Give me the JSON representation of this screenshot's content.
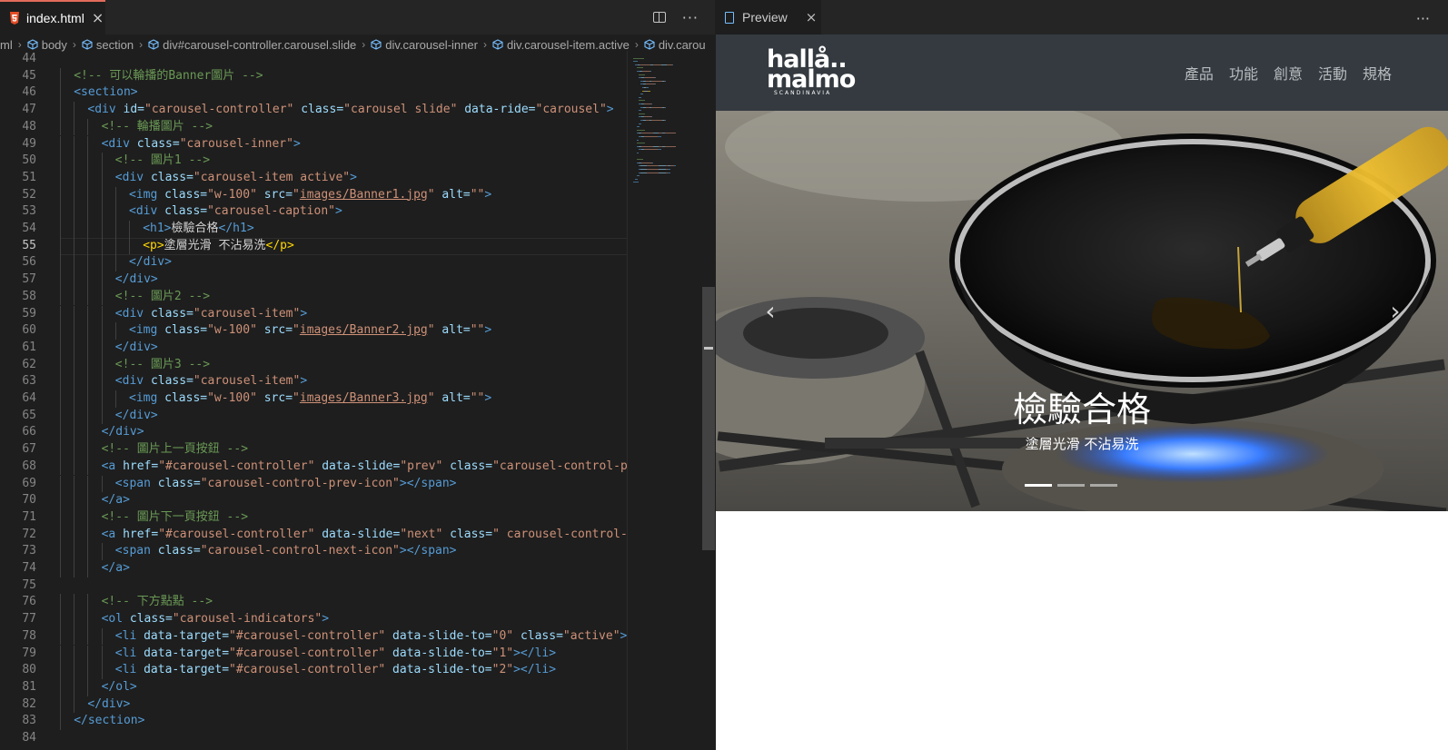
{
  "editor": {
    "tab": {
      "filename": "index.html",
      "close": "×",
      "more": "···"
    },
    "breadcrumb": [
      "ml",
      "body",
      "section",
      "div#carousel-controller.carousel.slide",
      "div.carousel-inner",
      "div.carousel-item.active",
      "div.carou"
    ],
    "lines": [
      {
        "n": "44",
        "indent": 0,
        "tokens": []
      },
      {
        "n": "45",
        "indent": 1,
        "tokens": [
          [
            "com",
            "<!-- 可以輪播的Banner圖片 -->"
          ]
        ]
      },
      {
        "n": "46",
        "indent": 1,
        "tokens": [
          [
            "tag",
            "<section>"
          ]
        ]
      },
      {
        "n": "47",
        "indent": 2,
        "tokens": [
          [
            "tag",
            "<div "
          ],
          [
            "attr",
            "id="
          ],
          [
            "str",
            "\"carousel-controller\" "
          ],
          [
            "attr",
            "class="
          ],
          [
            "str",
            "\"carousel slide\" "
          ],
          [
            "attr",
            "data-ride="
          ],
          [
            "str",
            "\"carousel\""
          ],
          [
            "tag",
            ">"
          ]
        ]
      },
      {
        "n": "48",
        "indent": 3,
        "tokens": [
          [
            "com",
            "<!-- 輪播圖片 -->"
          ]
        ]
      },
      {
        "n": "49",
        "indent": 3,
        "tokens": [
          [
            "tag",
            "<div "
          ],
          [
            "attr",
            "class="
          ],
          [
            "str",
            "\"carousel-inner\""
          ],
          [
            "tag",
            ">"
          ]
        ]
      },
      {
        "n": "50",
        "indent": 4,
        "tokens": [
          [
            "com",
            "<!-- 圖片1 -->"
          ]
        ]
      },
      {
        "n": "51",
        "indent": 4,
        "tokens": [
          [
            "tag",
            "<div "
          ],
          [
            "attr",
            "class="
          ],
          [
            "str",
            "\"carousel-item active\""
          ],
          [
            "tag",
            ">"
          ]
        ]
      },
      {
        "n": "52",
        "indent": 5,
        "tokens": [
          [
            "tag",
            "<img "
          ],
          [
            "attr",
            "class="
          ],
          [
            "str",
            "\"w-100\" "
          ],
          [
            "attr",
            "src="
          ],
          [
            "str",
            "\""
          ],
          [
            "link",
            "images/Banner1.jpg"
          ],
          [
            "str",
            "\" "
          ],
          [
            "attr",
            "alt="
          ],
          [
            "str",
            "\"\""
          ],
          [
            "tag",
            ">"
          ]
        ]
      },
      {
        "n": "53",
        "indent": 5,
        "tokens": [
          [
            "tag",
            "<div "
          ],
          [
            "attr",
            "class="
          ],
          [
            "str",
            "\"carousel-caption\""
          ],
          [
            "tag",
            ">"
          ]
        ]
      },
      {
        "n": "54",
        "indent": 6,
        "tokens": [
          [
            "tag",
            "<h1>"
          ],
          [
            "txt",
            "檢驗合格"
          ],
          [
            "tag",
            "</h1>"
          ]
        ]
      },
      {
        "n": "55",
        "indent": 6,
        "tokens": [
          [
            "brk",
            "<p>"
          ],
          [
            "txt",
            "塗層光滑 不沾易洗"
          ],
          [
            "brk",
            "</p>"
          ]
        ]
      },
      {
        "n": "56",
        "indent": 5,
        "tokens": [
          [
            "tag",
            "</div>"
          ]
        ]
      },
      {
        "n": "57",
        "indent": 4,
        "tokens": [
          [
            "tag",
            "</div>"
          ]
        ]
      },
      {
        "n": "58",
        "indent": 4,
        "tokens": [
          [
            "com",
            "<!-- 圖片2 -->"
          ]
        ]
      },
      {
        "n": "59",
        "indent": 4,
        "tokens": [
          [
            "tag",
            "<div "
          ],
          [
            "attr",
            "class="
          ],
          [
            "str",
            "\"carousel-item\""
          ],
          [
            "tag",
            ">"
          ]
        ]
      },
      {
        "n": "60",
        "indent": 5,
        "tokens": [
          [
            "tag",
            "<img "
          ],
          [
            "attr",
            "class="
          ],
          [
            "str",
            "\"w-100\" "
          ],
          [
            "attr",
            "src="
          ],
          [
            "str",
            "\""
          ],
          [
            "link",
            "images/Banner2.jpg"
          ],
          [
            "str",
            "\" "
          ],
          [
            "attr",
            "alt="
          ],
          [
            "str",
            "\"\""
          ],
          [
            "tag",
            ">"
          ]
        ]
      },
      {
        "n": "61",
        "indent": 4,
        "tokens": [
          [
            "tag",
            "</div>"
          ]
        ]
      },
      {
        "n": "62",
        "indent": 4,
        "tokens": [
          [
            "com",
            "<!-- 圖片3 -->"
          ]
        ]
      },
      {
        "n": "63",
        "indent": 4,
        "tokens": [
          [
            "tag",
            "<div "
          ],
          [
            "attr",
            "class="
          ],
          [
            "str",
            "\"carousel-item\""
          ],
          [
            "tag",
            ">"
          ]
        ]
      },
      {
        "n": "64",
        "indent": 5,
        "tokens": [
          [
            "tag",
            "<img "
          ],
          [
            "attr",
            "class="
          ],
          [
            "str",
            "\"w-100\" "
          ],
          [
            "attr",
            "src="
          ],
          [
            "str",
            "\""
          ],
          [
            "link",
            "images/Banner3.jpg"
          ],
          [
            "str",
            "\" "
          ],
          [
            "attr",
            "alt="
          ],
          [
            "str",
            "\"\""
          ],
          [
            "tag",
            ">"
          ]
        ]
      },
      {
        "n": "65",
        "indent": 4,
        "tokens": [
          [
            "tag",
            "</div>"
          ]
        ]
      },
      {
        "n": "66",
        "indent": 3,
        "tokens": [
          [
            "tag",
            "</div>"
          ]
        ]
      },
      {
        "n": "67",
        "indent": 3,
        "tokens": [
          [
            "com",
            "<!-- 圖片上一頁按鈕 -->"
          ]
        ]
      },
      {
        "n": "68",
        "indent": 3,
        "tokens": [
          [
            "tag",
            "<a "
          ],
          [
            "attr",
            "href="
          ],
          [
            "str",
            "\"#carousel-controller\" "
          ],
          [
            "attr",
            "data-slide="
          ],
          [
            "str",
            "\"prev\" "
          ],
          [
            "attr",
            "class="
          ],
          [
            "str",
            "\"carousel-control-prev"
          ]
        ]
      },
      {
        "n": "69",
        "indent": 4,
        "tokens": [
          [
            "tag",
            "<span "
          ],
          [
            "attr",
            "class="
          ],
          [
            "str",
            "\"carousel-control-prev-icon\""
          ],
          [
            "tag",
            "></span>"
          ]
        ]
      },
      {
        "n": "70",
        "indent": 3,
        "tokens": [
          [
            "tag",
            "</a>"
          ]
        ]
      },
      {
        "n": "71",
        "indent": 3,
        "tokens": [
          [
            "com",
            "<!-- 圖片下一頁按鈕 -->"
          ]
        ]
      },
      {
        "n": "72",
        "indent": 3,
        "tokens": [
          [
            "tag",
            "<a "
          ],
          [
            "attr",
            "href="
          ],
          [
            "str",
            "\"#carousel-controller\" "
          ],
          [
            "attr",
            "data-slide="
          ],
          [
            "str",
            "\"next\" "
          ],
          [
            "attr",
            "class="
          ],
          [
            "str",
            "\" carousel-control-nex"
          ]
        ]
      },
      {
        "n": "73",
        "indent": 4,
        "tokens": [
          [
            "tag",
            "<span "
          ],
          [
            "attr",
            "class="
          ],
          [
            "str",
            "\"carousel-control-next-icon\""
          ],
          [
            "tag",
            "></span>"
          ]
        ]
      },
      {
        "n": "74",
        "indent": 3,
        "tokens": [
          [
            "tag",
            "</a>"
          ]
        ]
      },
      {
        "n": "75",
        "indent": 0,
        "tokens": []
      },
      {
        "n": "76",
        "indent": 3,
        "tokens": [
          [
            "com",
            "<!-- 下方點點 -->"
          ]
        ]
      },
      {
        "n": "77",
        "indent": 3,
        "tokens": [
          [
            "tag",
            "<ol "
          ],
          [
            "attr",
            "class="
          ],
          [
            "str",
            "\"carousel-indicators\""
          ],
          [
            "tag",
            ">"
          ]
        ]
      },
      {
        "n": "78",
        "indent": 4,
        "tokens": [
          [
            "tag",
            "<li "
          ],
          [
            "attr",
            "data-target="
          ],
          [
            "str",
            "\"#carousel-controller\" "
          ],
          [
            "attr",
            "data-slide-to="
          ],
          [
            "str",
            "\"0\" "
          ],
          [
            "attr",
            "class="
          ],
          [
            "str",
            "\"active\""
          ],
          [
            "tag",
            "></l"
          ]
        ]
      },
      {
        "n": "79",
        "indent": 4,
        "tokens": [
          [
            "tag",
            "<li "
          ],
          [
            "attr",
            "data-target="
          ],
          [
            "str",
            "\"#carousel-controller\" "
          ],
          [
            "attr",
            "data-slide-to="
          ],
          [
            "str",
            "\"1\""
          ],
          [
            "tag",
            "></li>"
          ]
        ]
      },
      {
        "n": "80",
        "indent": 4,
        "tokens": [
          [
            "tag",
            "<li "
          ],
          [
            "attr",
            "data-target="
          ],
          [
            "str",
            "\"#carousel-controller\" "
          ],
          [
            "attr",
            "data-slide-to="
          ],
          [
            "str",
            "\"2\""
          ],
          [
            "tag",
            "></li>"
          ]
        ]
      },
      {
        "n": "81",
        "indent": 3,
        "tokens": [
          [
            "tag",
            "</ol>"
          ]
        ]
      },
      {
        "n": "82",
        "indent": 2,
        "tokens": [
          [
            "tag",
            "</div>"
          ]
        ]
      },
      {
        "n": "83",
        "indent": 1,
        "tokens": [
          [
            "tag",
            "</section>"
          ]
        ]
      },
      {
        "n": "84",
        "indent": 0,
        "tokens": []
      }
    ],
    "current_line": "55"
  },
  "preview": {
    "tab": {
      "title": "Preview",
      "close": "×",
      "more": "···"
    },
    "logo": {
      "line1": "hallå..",
      "line2": "malmo",
      "line3": "SCANDINAVIA"
    },
    "nav": [
      "產品",
      "功能",
      "創意",
      "活動",
      "規格"
    ],
    "carousel": {
      "caption_title": "檢驗合格",
      "caption_text": "塗層光滑 不沾易洗",
      "prev_icon": "‹",
      "next_icon": "›",
      "slide_count": 3,
      "active_index": 0
    }
  }
}
